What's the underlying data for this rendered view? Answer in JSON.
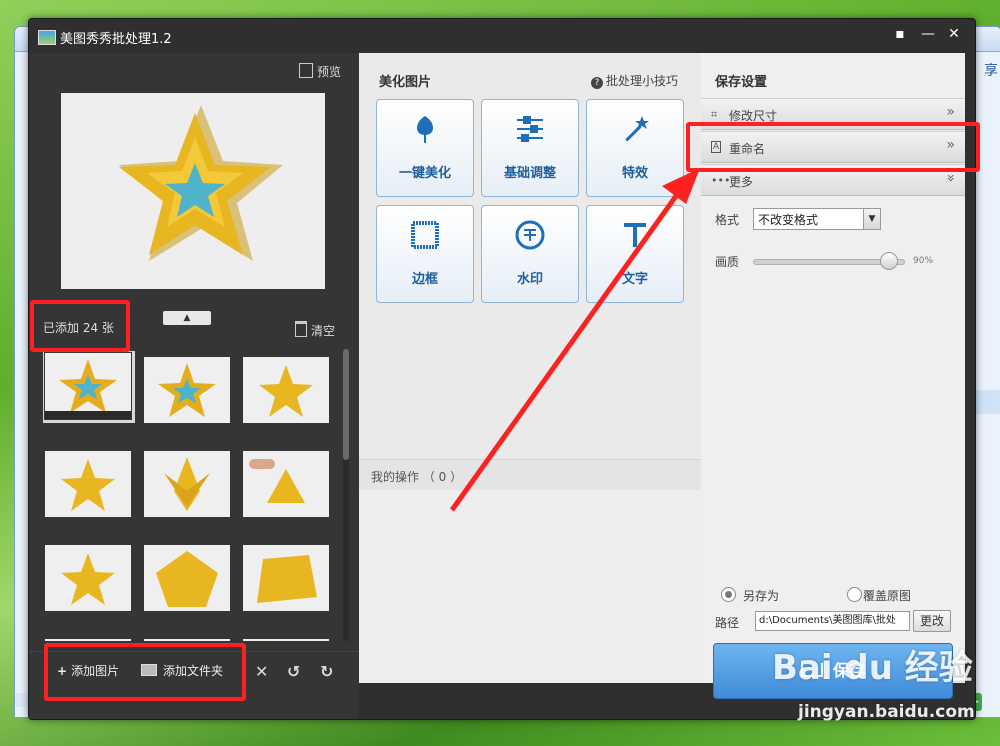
{
  "background": {
    "share_text": "享",
    "green_button": "+"
  },
  "window": {
    "title": "美图秀秀批处理1.2",
    "controls": [
      "▪",
      "—",
      "✕"
    ]
  },
  "left_panel": {
    "preview_label": "预览",
    "collapse_arrow": "▲",
    "count_label": "已添加 24 张",
    "clear_label": "清空",
    "scroll_fraction": 0.38,
    "bottom": {
      "add_image": "添加图片",
      "add_folder": "添加文件夹",
      "delete": "✕",
      "rotate_left": "↺",
      "rotate_right": "↻"
    }
  },
  "middle_panel": {
    "title": "美化图片",
    "tips": "批处理小技巧",
    "tools": [
      "一键美化",
      "基础调整",
      "特效",
      "边框",
      "水印",
      "文字"
    ],
    "ops_label": "我的操作 （ 0 ）"
  },
  "right_panel": {
    "title": "保存设置",
    "sections": [
      {
        "label": "修改尺寸",
        "arrow": "»"
      },
      {
        "label": "重命名",
        "arrow": "»"
      },
      {
        "label": "更多",
        "arrow": "»"
      }
    ],
    "format_label": "格式",
    "format_value": "不改变格式",
    "quality_label": "画质",
    "quality_value": "90%",
    "quality_percent": 90,
    "save_as_label": "另存为",
    "overwrite_label": "覆盖原图",
    "path_label": "路径",
    "path_value": "d:\\Documents\\美图图库\\批处",
    "change_label": "更改",
    "save_label": "保存"
  },
  "watermark": {
    "logo": "Bai du 经验",
    "url": "jingyan.baidu.com"
  },
  "colors": {
    "accent_blue": "#1e5f9e",
    "annotation_red": "#ff2020",
    "save_blue": "#3f8bd8"
  }
}
